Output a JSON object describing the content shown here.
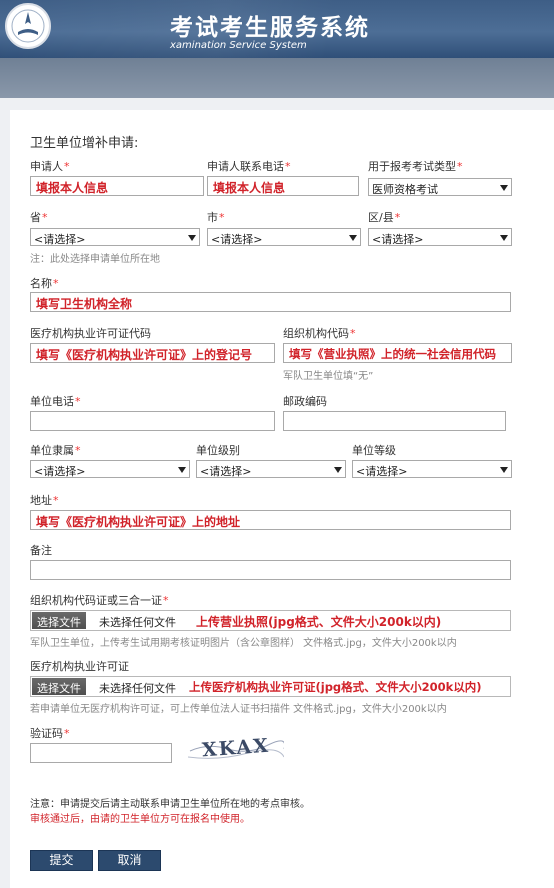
{
  "header": {
    "title": "考试考生服务系统",
    "subtitle": "xamination Service System"
  },
  "form": {
    "section_title": "卫生单位增补申请:",
    "applicant": {
      "label": "申请人",
      "required": "*",
      "value": "填报本人信息"
    },
    "applicant_phone": {
      "label": "申请人联系电话",
      "required": "*",
      "value": "填报本人信息"
    },
    "exam_type": {
      "label": "用于报考考试类型",
      "required": "*",
      "value": "医师资格考试"
    },
    "province": {
      "label": "省",
      "required": "*",
      "value": "<请选择>"
    },
    "city": {
      "label": "市",
      "required": "*",
      "value": "<请选择>"
    },
    "county": {
      "label": "区/县",
      "required": "*",
      "value": "<请选择>"
    },
    "region_note": "注：此处选择申请单位所在地",
    "name": {
      "label": "名称",
      "required": "*",
      "value": "填写卫生机构全称"
    },
    "license_code": {
      "label": "医疗机构执业许可证代码",
      "value": "填写《医疗机构执业许可证》上的登记号"
    },
    "org_code": {
      "label": "组织机构代码",
      "required": "*",
      "value": "填写《营业执照》上的统一社会信用代码",
      "note": "军队卫生单位填“无”"
    },
    "unit_phone": {
      "label": "单位电话",
      "required": "*",
      "value": ""
    },
    "postcode": {
      "label": "邮政编码",
      "value": ""
    },
    "affiliation": {
      "label": "单位隶属",
      "required": "*",
      "value": "<请选择>"
    },
    "unit_level": {
      "label": "单位级别",
      "value": "<请选择>"
    },
    "unit_grade": {
      "label": "单位等级",
      "value": "<请选择>"
    },
    "address": {
      "label": "地址",
      "required": "*",
      "value": "填写《医疗机构执业许可证》上的地址"
    },
    "remark": {
      "label": "备注",
      "value": ""
    },
    "org_cert": {
      "label": "组织机构代码证或三合一证",
      "required": "*",
      "button": "选择文件",
      "status": "未选择任何文件",
      "annotation": "上传营业执照(jpg格式、文件大小200k以内)",
      "note": "军队卫生单位，上传考生试用期考核证明图片（含公章图样） 文件格式.jpg，文件大小200k以内"
    },
    "license_cert": {
      "label": "医疗机构执业许可证",
      "button": "选择文件",
      "status": "未选择任何文件",
      "annotation": "上传医疗机构执业许可证(jpg格式、文件大小200k以内)",
      "note": "若申请单位无医疗机构许可证，可上传单位法人证书扫描件 文件格式.jpg，文件大小200k以内"
    },
    "captcha": {
      "label": "验证码",
      "required": "*",
      "value": "",
      "image_text": "XKAX"
    },
    "notice_line1": "注意：申请提交后请主动联系申请卫生单位所在地的考点审核。",
    "notice_line2": "审核通过后，由请的卫生单位方可在报名中使用。",
    "submit": "提交",
    "cancel": "取消"
  },
  "colors": {
    "header": "#3e5e86",
    "header_band": "#7d8da1",
    "required": "#e33333",
    "annotation": "#d1232a",
    "button": "#2c4a6e"
  }
}
